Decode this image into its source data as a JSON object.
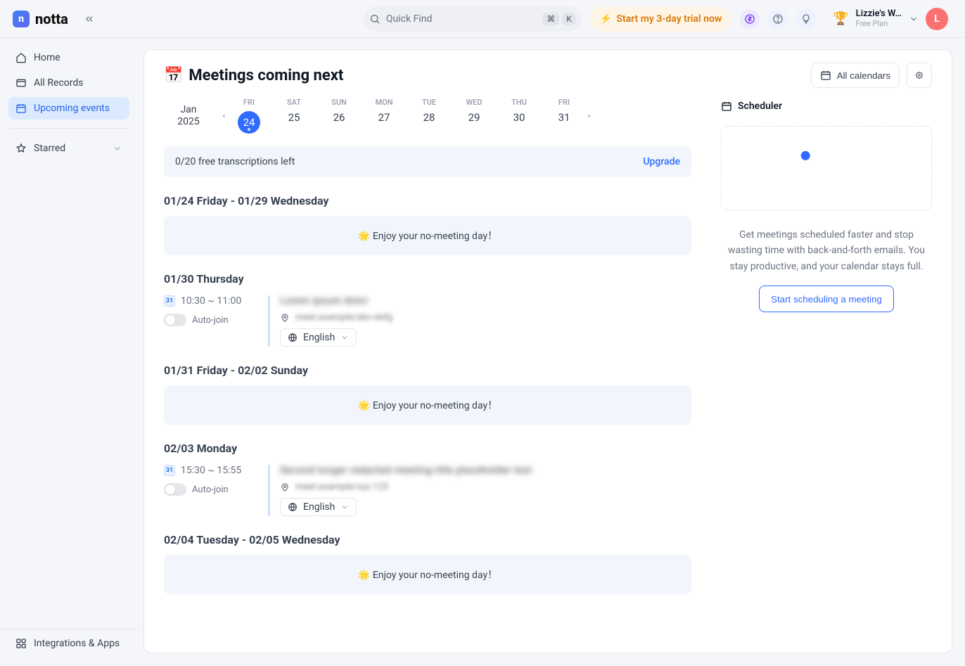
{
  "brand": "notta",
  "topbar": {
    "search_placeholder": "Quick Find",
    "kbd1": "⌘",
    "kbd2": "K",
    "trial_label": "Start my 3-day trial now",
    "user_name": "Lizzie's W…",
    "user_plan": "Free Plan",
    "avatar_initial": "L"
  },
  "sidebar": {
    "items": [
      {
        "label": "Home"
      },
      {
        "label": "All Records"
      },
      {
        "label": "Upcoming events"
      },
      {
        "label": "Starred"
      }
    ],
    "integrations": "Integrations & Apps"
  },
  "page": {
    "title_emoji": "📅",
    "title": "Meetings coming next",
    "all_calendars": "All calendars"
  },
  "calendar": {
    "month": "Jan",
    "year": "2025",
    "days": [
      {
        "dow": "FRI",
        "num": "24",
        "active": true
      },
      {
        "dow": "SAT",
        "num": "25"
      },
      {
        "dow": "SUN",
        "num": "26"
      },
      {
        "dow": "MON",
        "num": "27"
      },
      {
        "dow": "TUE",
        "num": "28"
      },
      {
        "dow": "WED",
        "num": "29"
      },
      {
        "dow": "THU",
        "num": "30"
      },
      {
        "dow": "FRI",
        "num": "31"
      }
    ]
  },
  "banner": {
    "text": "0/20 free transcriptions left",
    "upgrade": "Upgrade"
  },
  "sections": [
    {
      "range": "01/24 Friday - 01/29 Wednesday",
      "no_meeting": "🌟 Enjoy your no-meeting day！"
    },
    {
      "range": "01/30 Thursday",
      "meeting": {
        "time": "10:30 ~ 11:00",
        "auto_join": "Auto-join",
        "title_blur": "Lorem ipsum dolor",
        "location_blur": "meet.example/abc-defg",
        "language": "English"
      }
    },
    {
      "range": "01/31 Friday - 02/02 Sunday",
      "no_meeting": "🌟 Enjoy your no-meeting day！"
    },
    {
      "range": "02/03 Monday",
      "meeting": {
        "time": "15:30 ~ 15:55",
        "auto_join": "Auto-join",
        "title_blur": "Second longer redacted meeting title placeholder text",
        "location_blur": "meet.example/xyz-123",
        "language": "English"
      }
    },
    {
      "range": "02/04 Tuesday - 02/05 Wednesday",
      "no_meeting": "🌟 Enjoy your no-meeting day！"
    }
  ],
  "scheduler": {
    "title": "Scheduler",
    "text": "Get meetings scheduled faster and stop wasting time with back-and-forth emails. You stay productive, and your calendar stays full.",
    "button": "Start scheduling a meeting"
  }
}
